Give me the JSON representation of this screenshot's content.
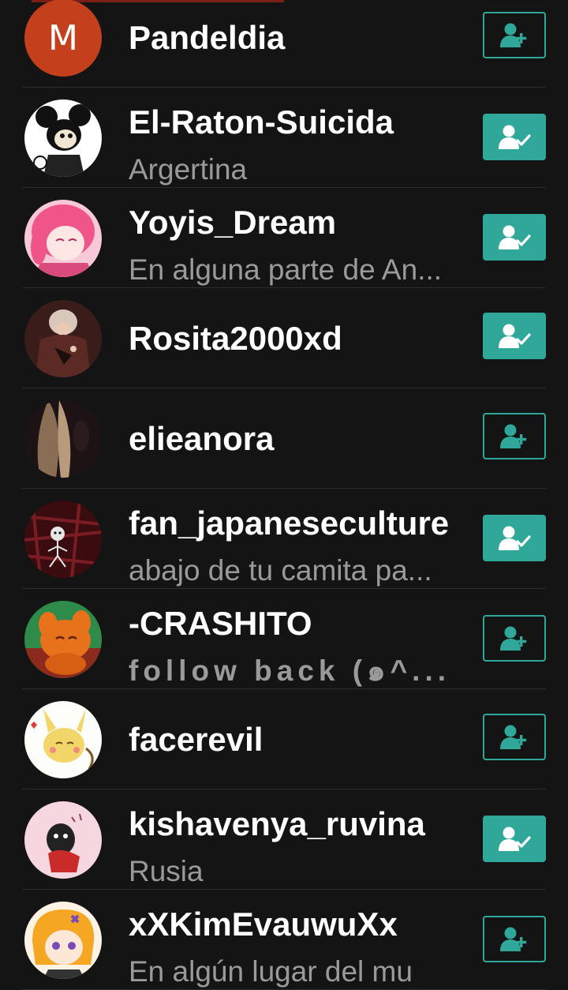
{
  "users": [
    {
      "name": "Pandeldia",
      "subtitle": "",
      "avatar_letter": "M",
      "following": false
    },
    {
      "name": "El-Raton-Suicida",
      "subtitle": "Argertina",
      "following": true
    },
    {
      "name": "Yoyis_Dream",
      "subtitle": "En alguna parte de An...",
      "following": true
    },
    {
      "name": "Rosita2000xd",
      "subtitle": "",
      "following": true
    },
    {
      "name": "elieanora",
      "subtitle": "",
      "following": false
    },
    {
      "name": "fan_japaneseculture",
      "subtitle": "abajo de tu camita pa...",
      "following": true
    },
    {
      "name": "-CRASHITO",
      "subtitle": "follow  back (๑^...",
      "following": false
    },
    {
      "name": "facerevil",
      "subtitle": "",
      "following": false
    },
    {
      "name": "kishavenya_ruvina",
      "subtitle": "Rusia",
      "following": true
    },
    {
      "name": "xXKimEvauwuXx",
      "subtitle": "En algún lugar del mu",
      "following": false
    }
  ],
  "colors": {
    "background": "#141414",
    "accent": "#2fa89a",
    "divider": "#2c2c2c",
    "subtitle": "#9a9a9a",
    "letter_avatar": "#c4401c"
  },
  "icons": {
    "follow": "person-add-icon",
    "following": "person-check-icon"
  }
}
